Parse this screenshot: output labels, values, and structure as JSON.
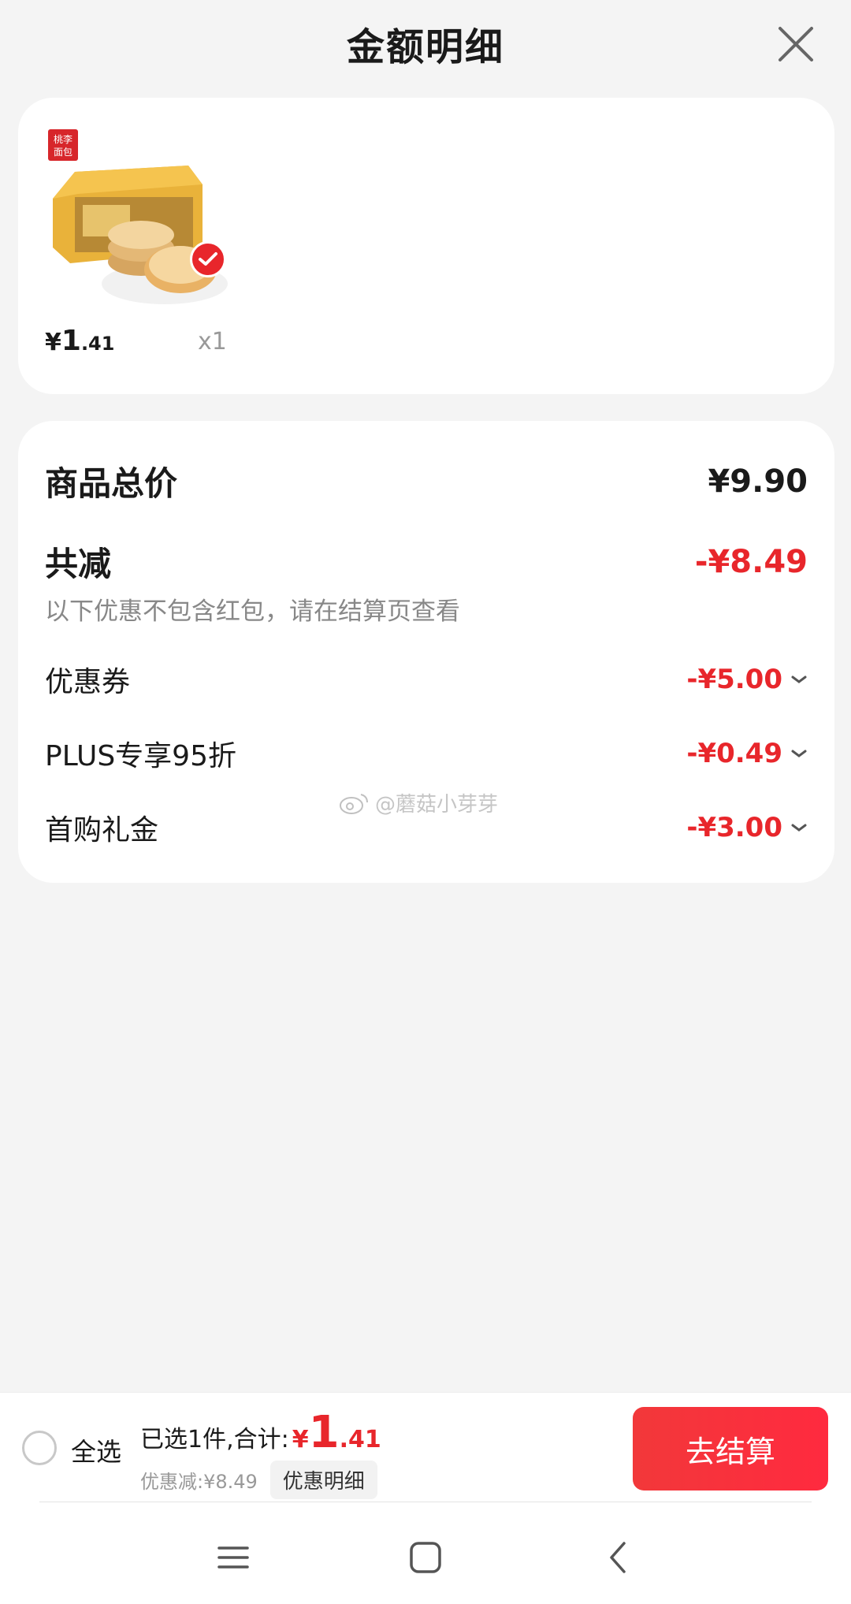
{
  "header": {
    "title": "金额明细",
    "close_icon": "close-icon"
  },
  "product": {
    "image_badge_line1": "桃李",
    "image_badge_line2": "面包",
    "price_currency": "¥",
    "price_int": "1",
    "price_dec": ".41",
    "quantity": "x1",
    "selected": true
  },
  "summary": {
    "total_label": "商品总价",
    "total_value": "¥9.90",
    "reduce_label": "共减",
    "reduce_value": "-¥8.49",
    "note": "以下优惠不包含红包，请在结算页查看",
    "items": [
      {
        "label": "优惠券",
        "value": "-¥5.00"
      },
      {
        "label": "PLUS专享95折",
        "value": "-¥0.49"
      },
      {
        "label": "首购礼金",
        "value": "-¥3.00"
      }
    ]
  },
  "watermark": "@蘑菇小芽芽",
  "bottom_bar": {
    "select_all": "全选",
    "total_prefix": "已选1件,合计:",
    "total_cur": "¥",
    "total_int": "1",
    "total_dec": ".41",
    "discount_text": "优惠减:¥8.49",
    "detail_chip": "优惠明细",
    "checkout": "去结算"
  },
  "colors": {
    "accent_red": "#e8262b",
    "background": "#f4f4f4"
  }
}
